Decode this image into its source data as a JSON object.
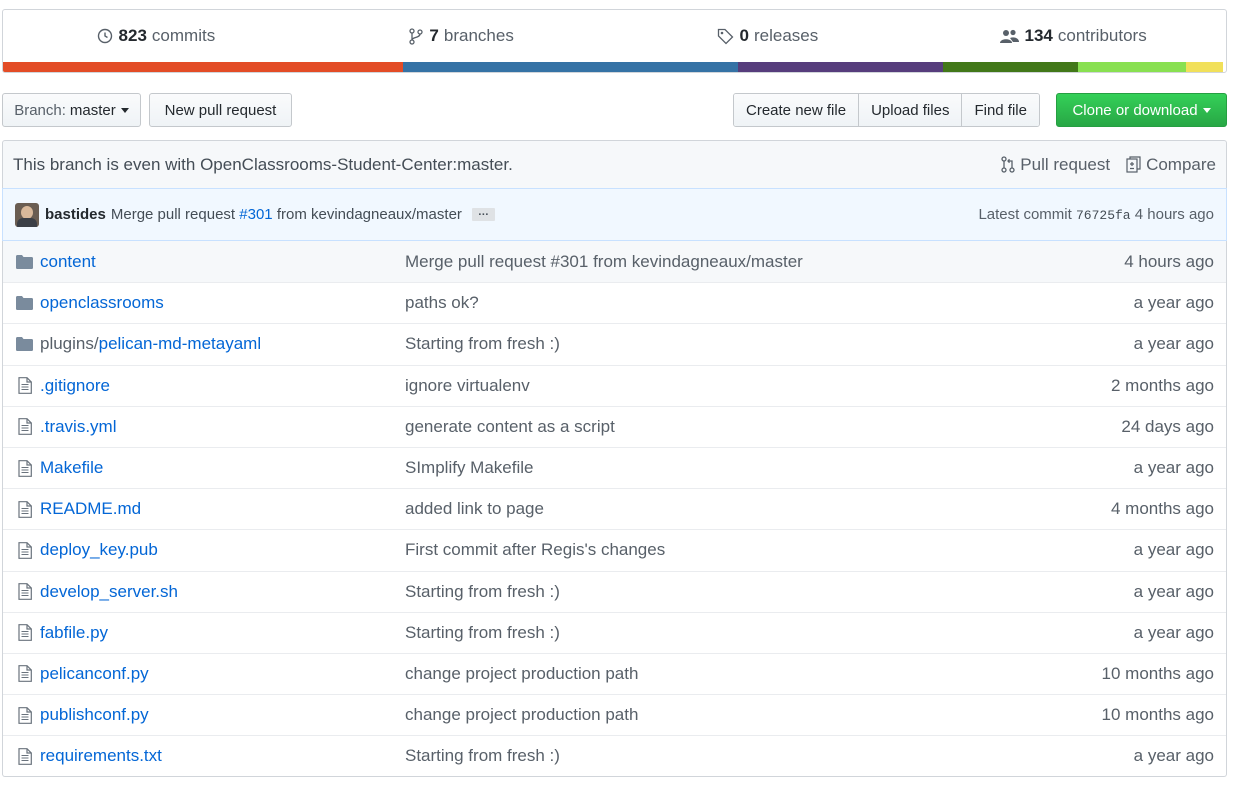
{
  "summary": {
    "commits": {
      "count": "823",
      "label": "commits",
      "icon": "history-icon"
    },
    "branches": {
      "count": "7",
      "label": "branches",
      "icon": "branch-icon"
    },
    "releases": {
      "count": "0",
      "label": "releases",
      "icon": "tag-icon"
    },
    "contributors": {
      "count": "134",
      "label": "contributors",
      "icon": "people-icon"
    },
    "language_colors": [
      "#e34c26",
      "#3572a5",
      "#563d7c",
      "#427819",
      "#89e051",
      "#f1e05a"
    ],
    "language_shares": [
      32.7,
      27.4,
      16.8,
      11.0,
      8.8,
      3.1
    ]
  },
  "toolbar": {
    "branch_prefix": "Branch:",
    "branch_name": "master",
    "new_pull_request": "New pull request",
    "create_new_file": "Create new file",
    "upload_files": "Upload files",
    "find_file": "Find file",
    "clone_or_download": "Clone or download"
  },
  "branch_info": {
    "message": "This branch is even with OpenClassrooms-Student-Center:master.",
    "pull_request": "Pull request",
    "compare": "Compare"
  },
  "commit": {
    "author": "bastides",
    "message_prefix": "Merge pull request",
    "pr_link": "#301",
    "message_suffix": "from kevindagneaux/master",
    "ellipsis": "…",
    "latest_label": "Latest commit",
    "sha": "76725fa",
    "age": "4 hours ago"
  },
  "files": [
    {
      "type": "dir",
      "prefix": "",
      "name": "content",
      "message": "Merge pull request #301 from kevindagneaux/master",
      "age": "4 hours ago"
    },
    {
      "type": "dir",
      "prefix": "",
      "name": "openclassrooms",
      "message": "paths ok?",
      "age": "a year ago"
    },
    {
      "type": "dir",
      "prefix": "plugins/",
      "name": "pelican-md-metayaml",
      "message": "Starting from fresh :)",
      "age": "a year ago"
    },
    {
      "type": "file",
      "prefix": "",
      "name": ".gitignore",
      "message": "ignore virtualenv",
      "age": "2 months ago"
    },
    {
      "type": "file",
      "prefix": "",
      "name": ".travis.yml",
      "message": "generate content as a script",
      "age": "24 days ago"
    },
    {
      "type": "file",
      "prefix": "",
      "name": "Makefile",
      "message": "SImplify Makefile",
      "age": "a year ago"
    },
    {
      "type": "file",
      "prefix": "",
      "name": "README.md",
      "message": "added link to page",
      "age": "4 months ago"
    },
    {
      "type": "file",
      "prefix": "",
      "name": "deploy_key.pub",
      "message": "First commit after Regis's changes",
      "age": "a year ago"
    },
    {
      "type": "file",
      "prefix": "",
      "name": "develop_server.sh",
      "message": "Starting from fresh :)",
      "age": "a year ago"
    },
    {
      "type": "file",
      "prefix": "",
      "name": "fabfile.py",
      "message": "Starting from fresh :)",
      "age": "a year ago"
    },
    {
      "type": "file",
      "prefix": "",
      "name": "pelicanconf.py",
      "message": "change project production path",
      "age": "10 months ago"
    },
    {
      "type": "file",
      "prefix": "",
      "name": "publishconf.py",
      "message": "change project production path",
      "age": "10 months ago"
    },
    {
      "type": "file",
      "prefix": "",
      "name": "requirements.txt",
      "message": "Starting from fresh :)",
      "age": "a year ago"
    }
  ]
}
